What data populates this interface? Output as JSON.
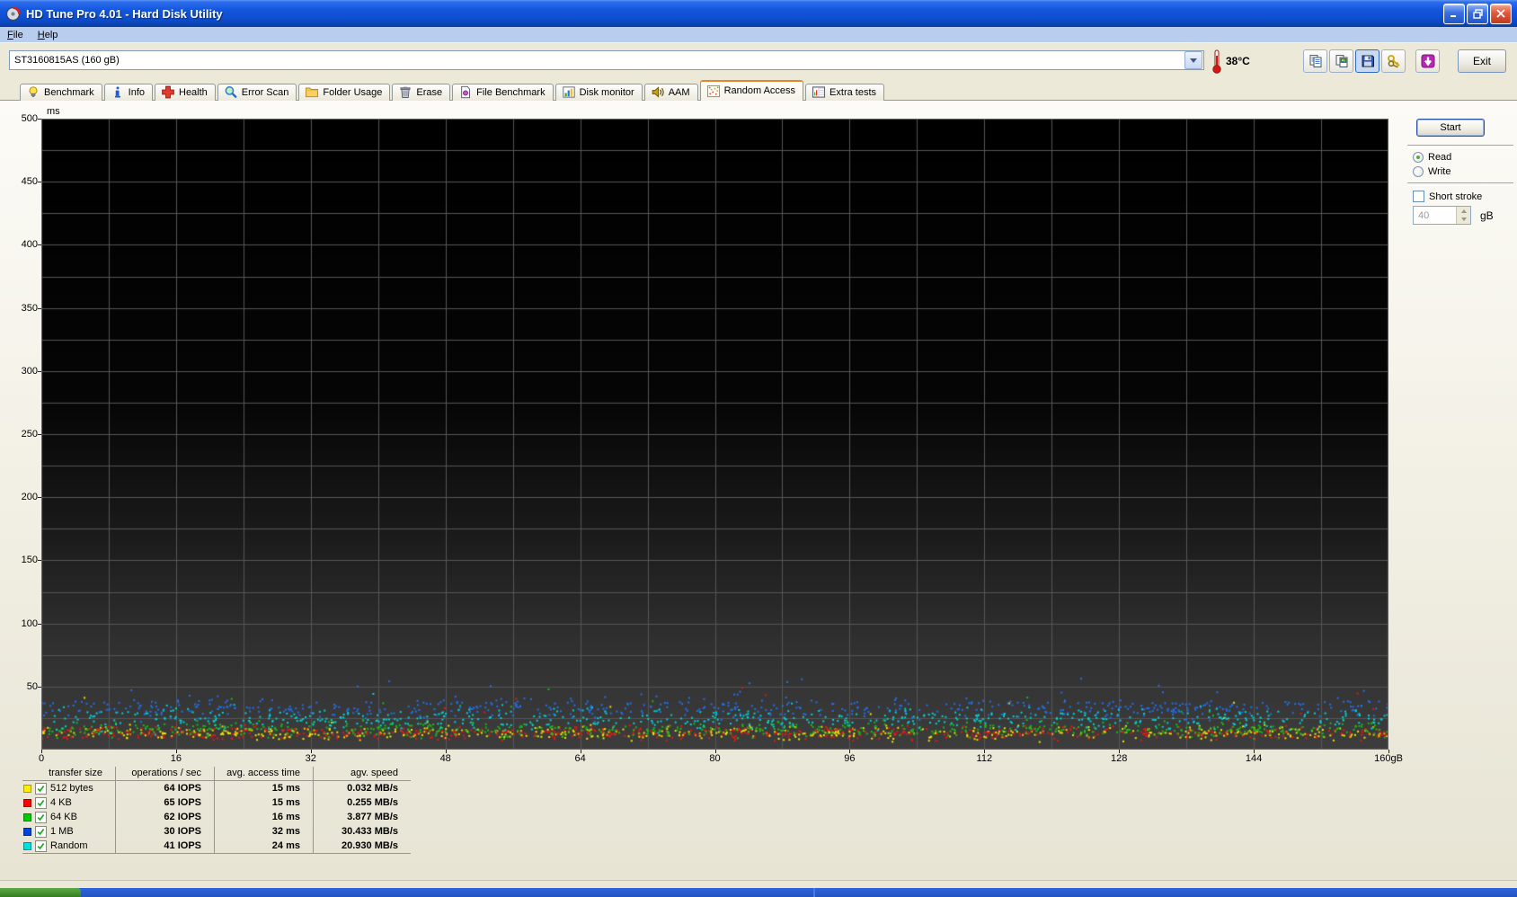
{
  "window": {
    "title": "HD Tune Pro 4.01 - Hard Disk Utility"
  },
  "menu": {
    "items": [
      {
        "label": "File"
      },
      {
        "label": "Help"
      }
    ]
  },
  "toolbar": {
    "drive_selector": {
      "value": "ST3160815AS (160 gB)"
    },
    "temperature": "38°C",
    "buttons": [
      {
        "name": "copy-text-button",
        "icon": "copy-doc",
        "active": false
      },
      {
        "name": "copy-image-button",
        "icon": "copy-image",
        "active": false
      },
      {
        "name": "save-button",
        "icon": "floppy",
        "active": true
      },
      {
        "name": "options-button",
        "icon": "keys",
        "active": false
      },
      {
        "name": "download-button",
        "icon": "download",
        "active": false,
        "gapped": true
      }
    ],
    "exit_label": "Exit"
  },
  "tabs": [
    {
      "label": "Benchmark",
      "icon": "bulb",
      "active": false
    },
    {
      "label": "Info",
      "icon": "info",
      "active": false
    },
    {
      "label": "Health",
      "icon": "health",
      "active": false
    },
    {
      "label": "Error Scan",
      "icon": "magnifier",
      "active": false
    },
    {
      "label": "Folder Usage",
      "icon": "folder",
      "active": false
    },
    {
      "label": "Erase",
      "icon": "trash",
      "active": false
    },
    {
      "label": "File Benchmark",
      "icon": "file-benchmark",
      "active": false
    },
    {
      "label": "Disk monitor",
      "icon": "disk-monitor",
      "active": false
    },
    {
      "label": "AAM",
      "icon": "speaker",
      "active": false
    },
    {
      "label": "Random Access",
      "icon": "scatter",
      "active": true
    },
    {
      "label": "Extra tests",
      "icon": "extra-tests",
      "active": false
    }
  ],
  "panel": {
    "start_label": "Start",
    "read_label": "Read",
    "write_label": "Write",
    "read_selected": true,
    "short_stroke_label": "Short stroke",
    "short_stroke_checked": false,
    "short_stroke_value": "40",
    "short_stroke_unit": "gB"
  },
  "chart_data": {
    "type": "scatter",
    "title": "Random access time vs disk position",
    "xlabel": "gB",
    "ylabel": "ms",
    "xlim": [
      0,
      160
    ],
    "ylim": [
      0,
      500
    ],
    "x_ticks": [
      0,
      16,
      32,
      48,
      64,
      80,
      96,
      112,
      128,
      144,
      160
    ],
    "x_tick_labels": [
      "0",
      "16",
      "32",
      "48",
      "64",
      "80",
      "96",
      "112",
      "128",
      "144",
      "160gB"
    ],
    "y_ticks": [
      500,
      450,
      400,
      350,
      300,
      250,
      200,
      150,
      100,
      50
    ],
    "minor_grid_x_step": 8,
    "minor_grid_y_step": 25,
    "grid_on": true,
    "grid_color": "#565656",
    "bg_top": "#000000",
    "bg_bottom": "#3d3d3d",
    "legend_position": "bottom-left-table",
    "series": [
      {
        "name": "512 bytes",
        "color": "#f2e400",
        "avg_access_ms": 15,
        "typical_range_ms": [
          6,
          22
        ],
        "outlier_max_ms": 48,
        "points": 560,
        "seed": 11,
        "base": 13,
        "spread": 9,
        "min": 6,
        "tail": 30,
        "tailp": 0.02
      },
      {
        "name": "4 KB",
        "color": "#e81616",
        "avg_access_ms": 15,
        "typical_range_ms": [
          7,
          22
        ],
        "outlier_max_ms": 52,
        "points": 560,
        "seed": 22,
        "base": 13,
        "spread": 9,
        "min": 7,
        "tail": 32,
        "tailp": 0.02
      },
      {
        "name": "64 KB",
        "color": "#17bb17",
        "avg_access_ms": 16,
        "typical_range_ms": [
          8,
          26
        ],
        "outlier_max_ms": 57,
        "points": 560,
        "seed": 33,
        "base": 16,
        "spread": 10,
        "min": 8,
        "tail": 32,
        "tailp": 0.03
      },
      {
        "name": "1 MB",
        "color": "#2070f0",
        "avg_access_ms": 32,
        "typical_range_ms": [
          22,
          44
        ],
        "outlier_max_ms": 60,
        "points": 560,
        "seed": 44,
        "base": 33,
        "spread": 13,
        "min": 20,
        "tail": 20,
        "tailp": 0.04
      },
      {
        "name": "Random",
        "color": "#00d4d4",
        "avg_access_ms": 24,
        "typical_range_ms": [
          13,
          35
        ],
        "outlier_max_ms": 52,
        "points": 560,
        "seed": 55,
        "base": 24,
        "spread": 14,
        "min": 11,
        "tail": 16,
        "tailp": 0.03
      }
    ]
  },
  "results_table": {
    "headers": [
      "transfer size",
      "operations / sec",
      "avg. access time",
      "agv. speed"
    ],
    "rows": [
      {
        "swatch": "#ffee00",
        "checked": true,
        "transfer_size": "512 bytes",
        "iops": "64 IOPS",
        "access_time": "15 ms",
        "speed": "0.032 MB/s"
      },
      {
        "swatch": "#ff0000",
        "checked": true,
        "transfer_size": "4 KB",
        "iops": "65 IOPS",
        "access_time": "15 ms",
        "speed": "0.255 MB/s"
      },
      {
        "swatch": "#00cc00",
        "checked": true,
        "transfer_size": "64 KB",
        "iops": "62 IOPS",
        "access_time": "16 ms",
        "speed": "3.877 MB/s"
      },
      {
        "swatch": "#0044dd",
        "checked": true,
        "transfer_size": "1 MB",
        "iops": "30 IOPS",
        "access_time": "32 ms",
        "speed": "30.433 MB/s"
      },
      {
        "swatch": "#00e0e0",
        "checked": true,
        "transfer_size": "Random",
        "iops": "41 IOPS",
        "access_time": "24 ms",
        "speed": "20.930 MB/s"
      }
    ]
  }
}
